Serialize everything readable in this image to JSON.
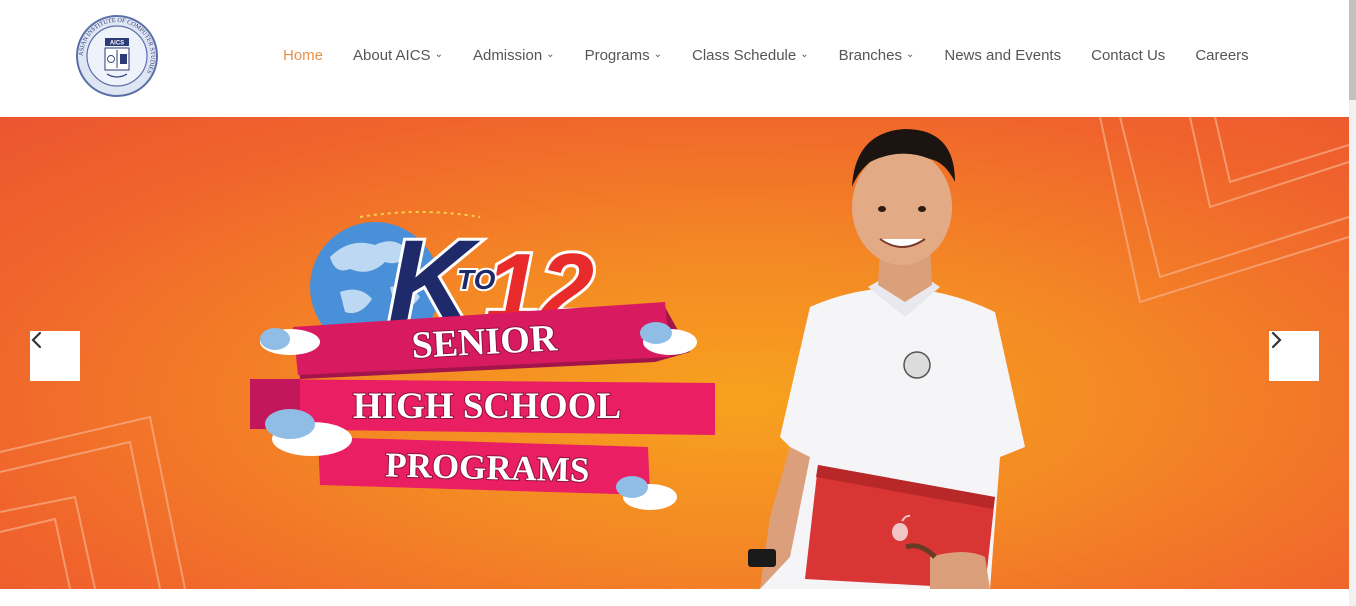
{
  "header": {
    "logo_text": "ASIAN INSTITUTE OF COMPUTER STUDIES",
    "logo_badge": "AICS"
  },
  "nav": {
    "items": [
      {
        "label": "Home",
        "active": true,
        "dropdown": false
      },
      {
        "label": "About AICS",
        "active": false,
        "dropdown": true
      },
      {
        "label": "Admission",
        "active": false,
        "dropdown": true
      },
      {
        "label": "Programs",
        "active": false,
        "dropdown": true
      },
      {
        "label": "Class Schedule",
        "active": false,
        "dropdown": true
      },
      {
        "label": "Branches",
        "active": false,
        "dropdown": true
      },
      {
        "label": "News and Events",
        "active": false,
        "dropdown": false
      },
      {
        "label": "Contact Us",
        "active": false,
        "dropdown": false
      },
      {
        "label": "Careers",
        "active": false,
        "dropdown": false
      }
    ]
  },
  "hero": {
    "k12_k": "K",
    "k12_to": "TO",
    "k12_12": "12",
    "banner_line1": "SENIOR",
    "banner_line2": "HIGH SCHOOL",
    "banner_line3": "PROGRAMS",
    "prev_icon": "chevron-left-icon",
    "next_icon": "chevron-right-icon"
  },
  "colors": {
    "nav_active": "#e8914a",
    "nav_text": "#555555",
    "hero_orange": "#f48a24",
    "ribbon_pink": "#d81b60",
    "ribbon_dark": "#a3154a",
    "k_navy": "#1f2a6b",
    "twelve_red": "#e82a2a"
  }
}
